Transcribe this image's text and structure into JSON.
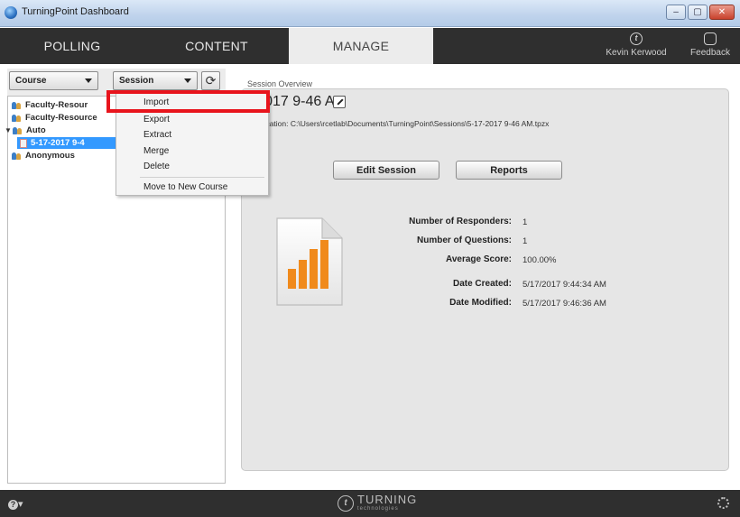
{
  "window": {
    "title": "TurningPoint Dashboard",
    "buttons": [
      "–",
      "▢",
      "✕"
    ]
  },
  "nav": {
    "tabs": [
      {
        "label": "POLLING",
        "active": false
      },
      {
        "label": "CONTENT",
        "active": false
      },
      {
        "label": "MANAGE",
        "active": true
      }
    ],
    "user_name": "Kevin Kerwood",
    "feedback_label": "Feedback"
  },
  "left_panel": {
    "course_dropdown": "Course",
    "session_dropdown": "Session",
    "tree": [
      {
        "label": "Faculty-Resour",
        "type": "course"
      },
      {
        "label": "Faculty-Resource",
        "type": "course"
      },
      {
        "label": "Auto",
        "type": "course",
        "expanded": true
      },
      {
        "label": "5-17-2017 9-4",
        "type": "session",
        "selected": true
      },
      {
        "label": "Anonymous",
        "type": "course"
      }
    ]
  },
  "context_menu": {
    "items": [
      "Import",
      "Export",
      "Extract",
      "Merge",
      "Delete",
      "Move to New Course"
    ],
    "highlighted": "Import"
  },
  "overview": {
    "section_label": "Session Overview",
    "session_title": "7-2017 9-46 AM",
    "location": "Location: C:\\Users\\rcetlab\\Documents\\TurningPoint\\Sessions\\5-17-2017 9-46 AM.tpzx",
    "edit_session_label": "Edit Session",
    "reports_label": "Reports",
    "stats": {
      "responders_label": "Number of Responders:",
      "responders_value": "1",
      "questions_label": "Number of Questions:",
      "questions_value": "1",
      "avg_score_label": "Average Score:",
      "avg_score_value": "100.00%",
      "date_created_label": "Date Created:",
      "date_created_value": "5/17/2017 9:44:34 AM",
      "date_modified_label": "Date Modified:",
      "date_modified_value": "5/17/2017 9:46:36 AM"
    }
  },
  "footer": {
    "brand_name": "TURNING",
    "brand_sub": "technologies"
  },
  "colors": {
    "nav_bg": "#2f2f2f",
    "highlight_red": "#e8141c",
    "selection_blue": "#3399ff",
    "chart_orange": "#f08a1c"
  }
}
